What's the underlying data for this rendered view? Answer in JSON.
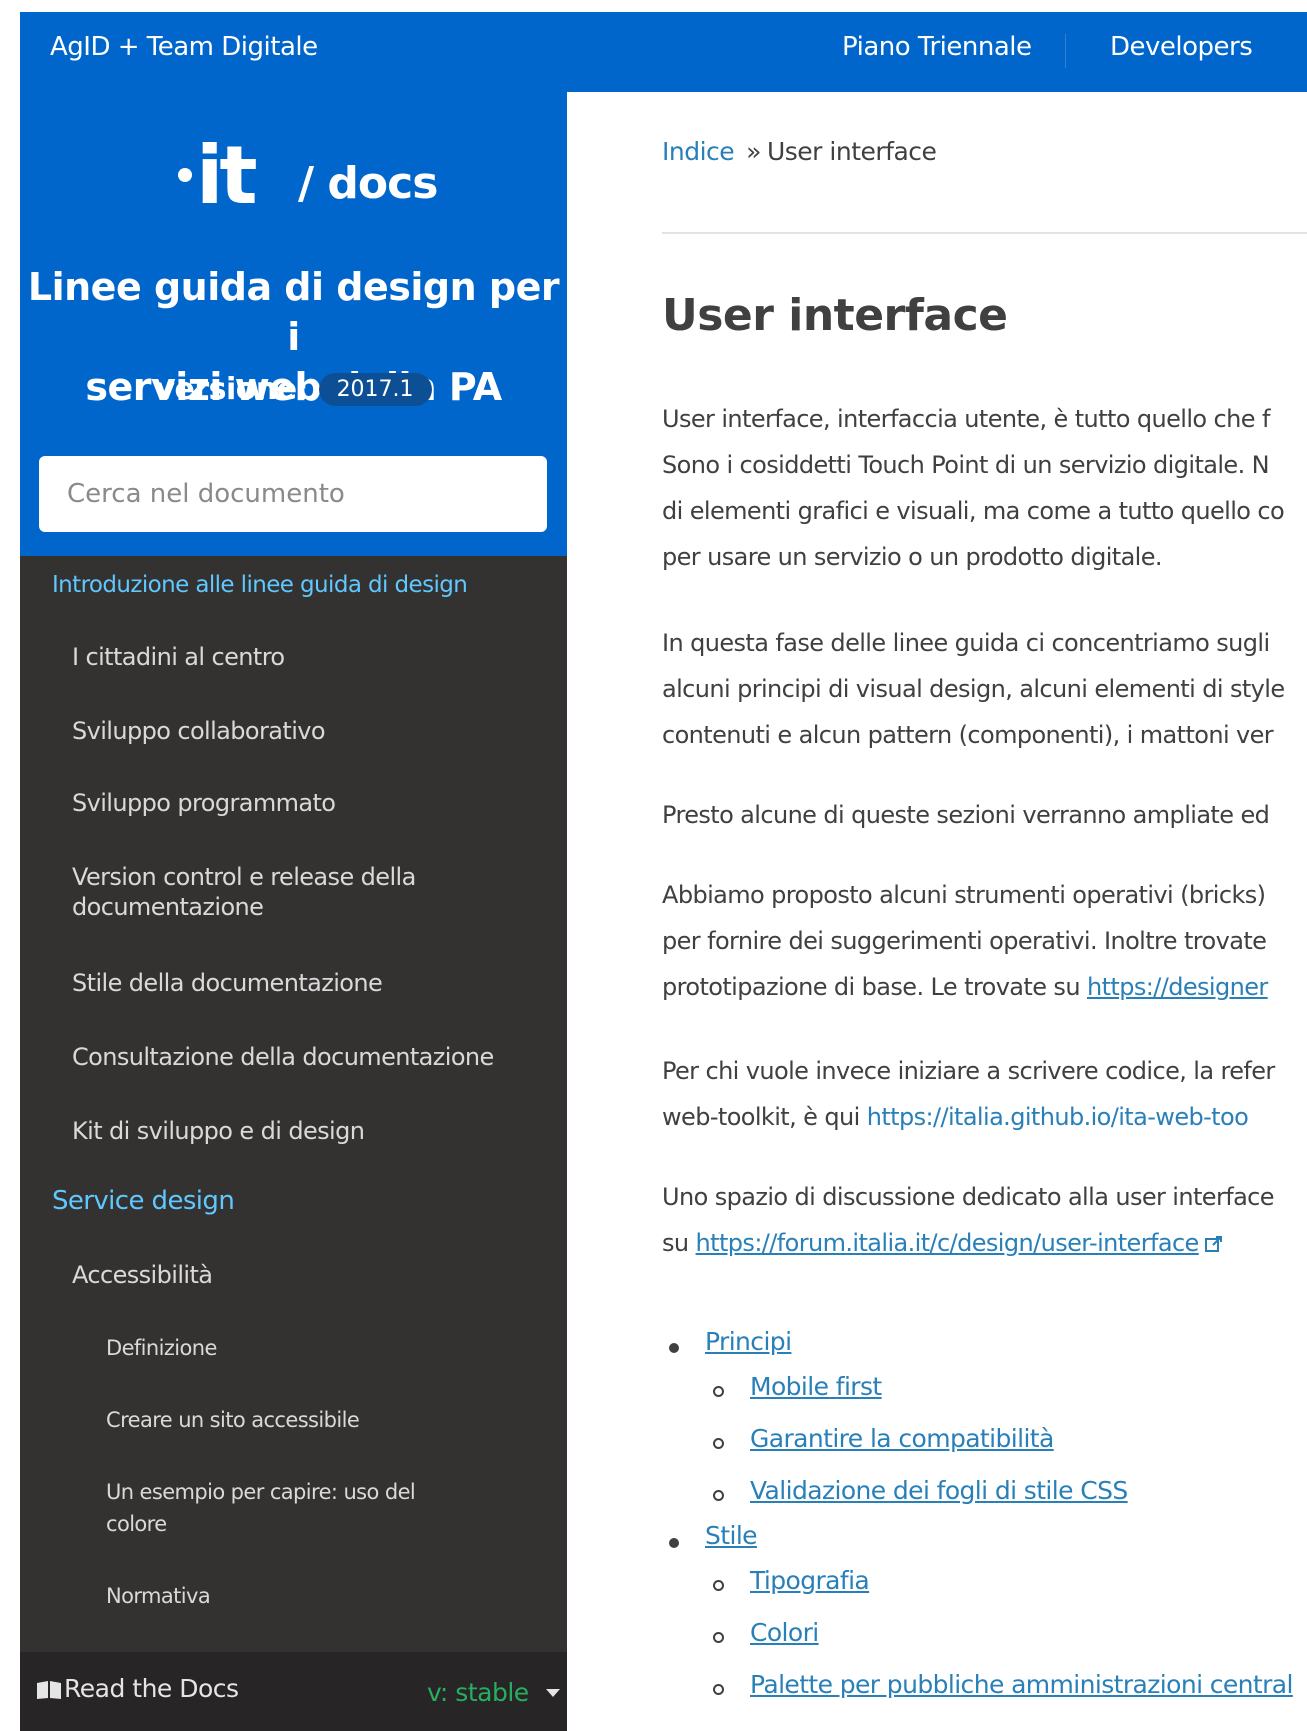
{
  "topbar": {
    "brand": "AgID + Team Digitale",
    "nav": [
      "Piano Triennale",
      "Developers"
    ],
    "color": "#0066cc"
  },
  "sidebar": {
    "logo_main": "it",
    "logo_suffix": "/ docs",
    "doc_title_line1": "Linee guida di design per i",
    "doc_title_line2": "servizi web della PA",
    "version_label": "versione:",
    "version_value": "2017.1",
    "search_placeholder": "Cerca nel documento",
    "nav": [
      {
        "label": "Introduzione alle linee guida di design",
        "level": 1
      },
      {
        "label": "I cittadini al centro",
        "level": 2
      },
      {
        "label": "Sviluppo collaborativo",
        "level": 2
      },
      {
        "label": "Sviluppo programmato",
        "level": 2
      },
      {
        "label": "Version control e release della",
        "label2": "documentazione",
        "level": 2
      },
      {
        "label": "Stile della documentazione",
        "level": 2
      },
      {
        "label": "Consultazione della documentazione",
        "level": 2
      },
      {
        "label": "Kit di sviluppo e di design",
        "level": 2
      },
      {
        "label": "Service design",
        "level": 1
      },
      {
        "label": "Accessibilità",
        "level": 2
      },
      {
        "label": "Definizione",
        "level": 3
      },
      {
        "label": "Creare un sito accessibile",
        "level": 3
      },
      {
        "label": "Un esempio per capire: uso del",
        "label2": "colore",
        "level": 3
      },
      {
        "label": "Normativa",
        "level": 3
      }
    ],
    "rtd_label": "Read the Docs",
    "rtd_version": "v: stable",
    "colors": {
      "header": "#0066cc",
      "nav_bg": "#343131",
      "nav_link": "#5ec8ff",
      "rtd_version": "#27ae60"
    }
  },
  "breadcrumb": {
    "home": "Indice",
    "separator": "»",
    "current": "User interface"
  },
  "page_title": "User interface",
  "paragraphs": {
    "p1": [
      "User interface, interfaccia utente, è tutto quello che f",
      "Sono i cosiddetti Touch Point di un servizio digitale. N",
      "di elementi grafici e visuali, ma come a tutto quello co",
      "per usare un servizio o un prodotto digitale."
    ],
    "p2": [
      "In questa fase delle linee guida ci concentriamo sugli",
      "alcuni principi di visual design, alcuni elementi di style",
      "contenuti e alcun pattern (componenti), i mattoni ver"
    ],
    "p3": "Presto alcune di queste sezioni verranno ampliate ed",
    "p4_l1": "Abbiamo proposto alcuni strumenti operativi (bricks)",
    "p4_l2": "per fornire dei suggerimenti operativi. Inoltre trovate",
    "p4_l3_text": "prototipazione di base. Le trovate su ",
    "p4_l3_link": "https://designer",
    "p5_l1": "Per chi vuole invece iniziare a scrivere codice, la refer",
    "p5_l2_text": "web-toolkit, è qui ",
    "p5_l2_link": "https://italia.github.io/ita-web-too",
    "p6_l1": "Uno spazio di discussione dedicato alla user interface",
    "p6_l2_text": "su ",
    "p6_l2_link": "https://forum.italia.it/c/design/user-interface"
  },
  "toc": [
    {
      "label": "Principi",
      "level": 1
    },
    {
      "label": "Mobile first",
      "level": 2
    },
    {
      "label": "Garantire la compatibilità",
      "level": 2
    },
    {
      "label": "Validazione dei fogli di stile CSS",
      "level": 2
    },
    {
      "label": "Stile",
      "level": 1
    },
    {
      "label": "Tipografia",
      "level": 2
    },
    {
      "label": "Colori",
      "level": 2
    },
    {
      "label": "Palette per pubbliche amministrazioni central",
      "level": 2
    }
  ]
}
